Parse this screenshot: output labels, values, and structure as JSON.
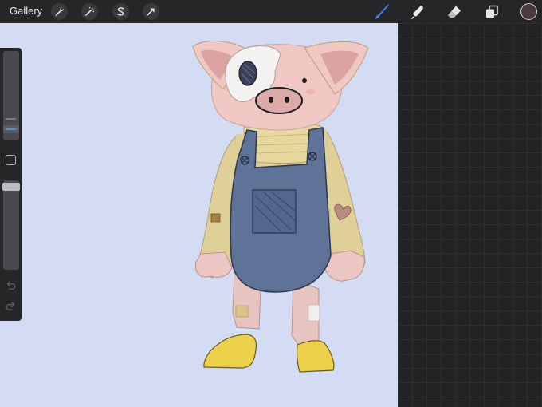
{
  "toolbar": {
    "gallery_label": "Gallery",
    "left_tools": [
      "wrench-icon",
      "magic-wand-icon",
      "selection-s-icon",
      "transform-arrow-icon"
    ],
    "right_tools": [
      "brush-icon",
      "smudge-icon",
      "eraser-icon",
      "layers-icon"
    ],
    "active_tool": "brush-icon",
    "active_color": "#4a3b3e",
    "accent_color": "#3d7fe0"
  },
  "sidebar": {
    "brush_size_level": 0.78,
    "opacity_level": 0.04,
    "controls": [
      "size-slider",
      "modify-button",
      "opacity-slider",
      "undo-button",
      "redo-button"
    ]
  },
  "canvas": {
    "background_color": "#d3dcf3",
    "artwork": "pig-character-drawing"
  }
}
